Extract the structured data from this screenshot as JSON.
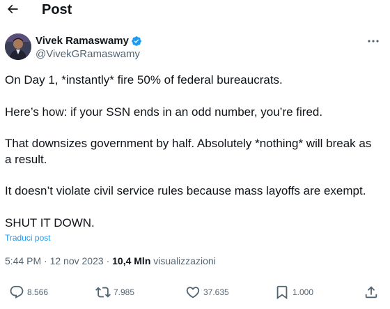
{
  "header": {
    "title": "Post",
    "back_icon": "arrow-left-icon"
  },
  "author": {
    "display_name": "Vivek Ramaswamy",
    "handle": "@VivekGRamaswamy",
    "verified": true,
    "verified_color": "#1d9bf0"
  },
  "tweet": {
    "paragraphs": [
      "On Day 1, *instantly* fire 50% of federal bureaucrats.",
      "Here’s how: if your SSN ends in an odd number, you’re fired.",
      "That downsizes government by half. Absolutely *nothing* will break as a result.",
      "It doesn’t violate civil service rules because mass layoffs are exempt.",
      "SHUT IT DOWN."
    ],
    "translate_label": "Traduci post"
  },
  "meta": {
    "time": "5:44 PM",
    "date": "12 nov 2023",
    "separator": "·",
    "views_count": "10,4 Mln",
    "views_label": "visualizzazioni"
  },
  "actions": {
    "replies": "8.566",
    "reposts": "7.985",
    "likes": "37.635",
    "bookmarks": "1.000"
  },
  "colors": {
    "accent": "#1d9bf0",
    "text": "#0f1419",
    "secondary": "#536471"
  }
}
